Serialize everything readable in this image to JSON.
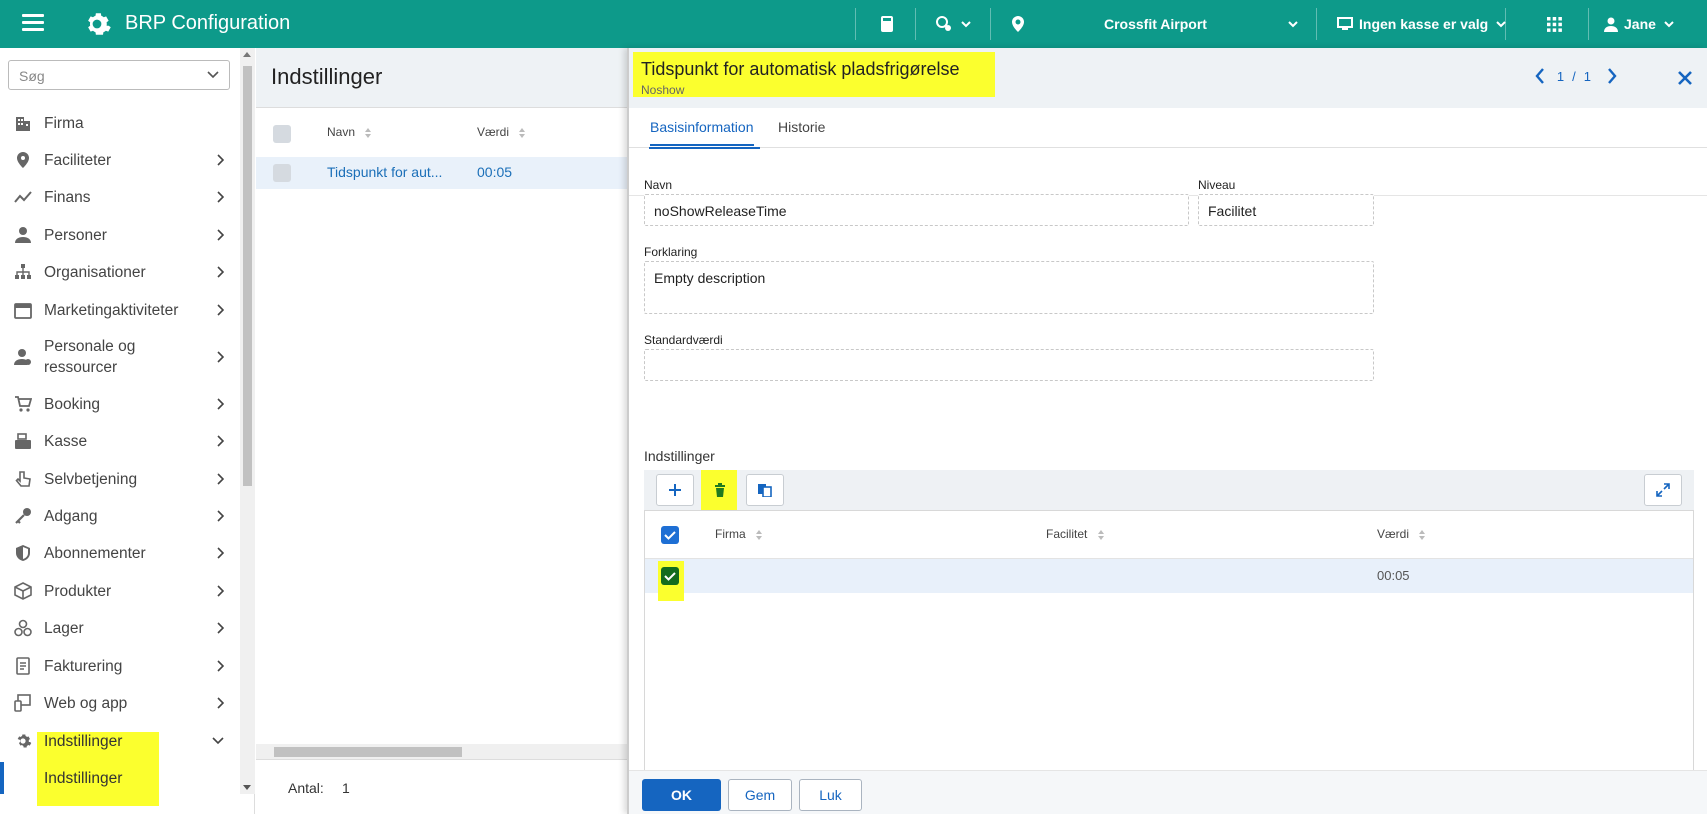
{
  "topbar": {
    "app_title": "BRP Configuration",
    "location": "Crossfit Airport",
    "register": "Ingen kasse er valg",
    "user": "Jane"
  },
  "sidebar": {
    "search_placeholder": "Søg",
    "items": [
      {
        "label": "Firma",
        "icon": "building-icon"
      },
      {
        "label": "Faciliteter",
        "icon": "map-pin-icon"
      },
      {
        "label": "Finans",
        "icon": "chart-line-icon"
      },
      {
        "label": "Personer",
        "icon": "person-icon"
      },
      {
        "label": "Organisationer",
        "icon": "org-chart-icon"
      },
      {
        "label": "Marketingaktiviteter",
        "icon": "calendar-icon"
      },
      {
        "label": "Personale og ressourcer",
        "icon": "staff-icon"
      },
      {
        "label": "Booking",
        "icon": "cart-icon"
      },
      {
        "label": "Kasse",
        "icon": "cash-register-icon"
      },
      {
        "label": "Selvbetjening",
        "icon": "hand-pointer-icon"
      },
      {
        "label": "Adgang",
        "icon": "key-icon"
      },
      {
        "label": "Abonnementer",
        "icon": "shield-icon"
      },
      {
        "label": "Produkter",
        "icon": "box-icon"
      },
      {
        "label": "Lager",
        "icon": "boxes-icon"
      },
      {
        "label": "Fakturering",
        "icon": "invoice-icon"
      },
      {
        "label": "Web og app",
        "icon": "devices-icon"
      },
      {
        "label": "Indstillinger",
        "icon": "gear-icon"
      }
    ],
    "sub_item": "Indstillinger"
  },
  "list": {
    "title": "Indstillinger",
    "columns": [
      "Navn",
      "Værdi"
    ],
    "rows": [
      {
        "name": "Tidspunkt for aut...",
        "value": "00:05"
      }
    ],
    "count_label": "Antal:",
    "count": "1"
  },
  "detail": {
    "title": "Tidspunkt for automatisk pladsfrigørelse",
    "subtitle": "Noshow",
    "pager_current": "1",
    "pager_sep": "/",
    "pager_total": "1",
    "tabs": [
      "Basisinformation",
      "Historie"
    ],
    "fields": {
      "name_label": "Navn",
      "name_value": "noShowReleaseTime",
      "level_label": "Niveau",
      "level_value": "Facilitet",
      "desc_label": "Forklaring",
      "desc_value": "Empty description",
      "default_label": "Standardværdi",
      "default_value": ""
    },
    "settings_label": "Indstillinger",
    "grid": {
      "columns": [
        "Firma",
        "Facilitet",
        "Værdi"
      ],
      "rows": [
        {
          "firma": "",
          "facilitet": "",
          "vaerdi": "00:05"
        }
      ]
    },
    "buttons": {
      "ok": "OK",
      "save": "Gem",
      "close": "Luk"
    }
  },
  "colors": {
    "topbar": "#0d9a8a",
    "accent": "#1565c0",
    "highlight": "#fbff2e"
  }
}
